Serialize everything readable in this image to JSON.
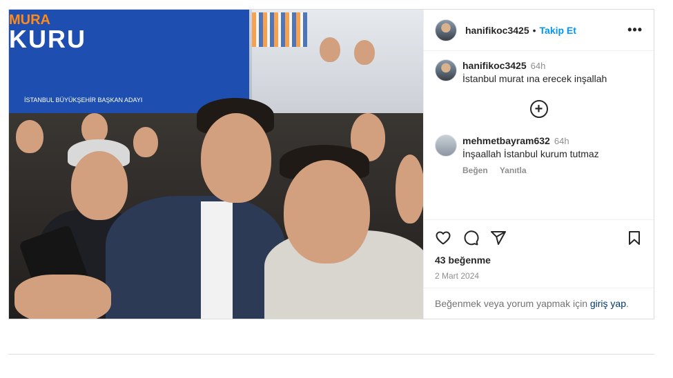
{
  "post": {
    "username": "hanifikoc3425",
    "separator": "•",
    "follow_label": "Takip Et",
    "more_label": "•••",
    "photo_banner": {
      "line1": "MURA",
      "line2": "KURU",
      "line3": "İSTANBUL BÜYÜKŞEHİR BAŞKAN ADAYI"
    }
  },
  "comments": [
    {
      "username": "hanifikoc3425",
      "time": "64h",
      "text": "İstanbul murat ına erecek inşallah"
    },
    {
      "username": "mehmetbayram632",
      "time": "64h",
      "text": "İnşaallah İstanbul kurum tutmaz",
      "actions": {
        "like": "Beğen",
        "reply": "Yanıtla"
      }
    }
  ],
  "load_more_label": "+",
  "stats": {
    "likes": "43 beğenme",
    "date": "2 Mart 2024"
  },
  "login_prompt": {
    "before": "Beğenmek veya yorum yapmak için ",
    "link": "giriş yap",
    "after": "."
  },
  "icons": {
    "like": "heart-icon",
    "comment": "comment-icon",
    "share": "share-icon",
    "save": "bookmark-icon"
  }
}
